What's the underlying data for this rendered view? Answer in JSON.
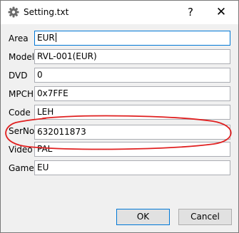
{
  "window": {
    "title": "Setting.txt",
    "help_glyph": "?",
    "close_glyph": "✕"
  },
  "fields": [
    {
      "label": "Area",
      "value": "EUR",
      "focused": true
    },
    {
      "label": "Model",
      "value": "RVL-001(EUR)"
    },
    {
      "label": "DVD",
      "value": "0"
    },
    {
      "label": "MPCH",
      "value": "0x7FFE"
    },
    {
      "label": "Code",
      "value": "LEH"
    },
    {
      "label": "SerNo",
      "value": "632011873",
      "annotated": true
    },
    {
      "label": "Video",
      "value": "PAL"
    },
    {
      "label": "Game",
      "value": "EU"
    }
  ],
  "buttons": {
    "ok": "OK",
    "cancel": "Cancel"
  },
  "colors": {
    "annotation": "#e02020",
    "focus_border": "#0078d7"
  },
  "icons": {
    "app": "gear-icon",
    "help": "help-icon",
    "close": "close-icon"
  }
}
